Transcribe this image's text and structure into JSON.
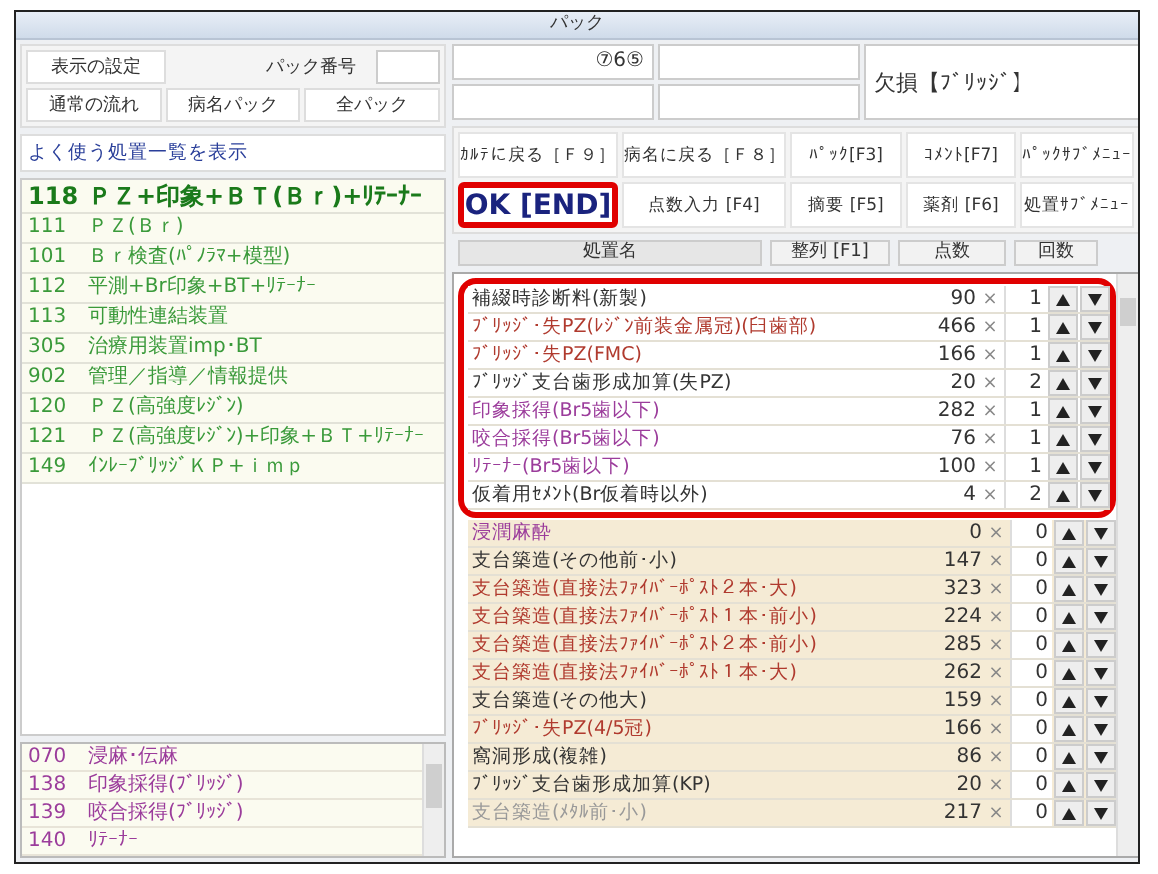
{
  "window": {
    "title": "パック"
  },
  "settings": {
    "display_button": "表示の設定",
    "pack_number_label": "パック番号",
    "buttons": [
      "通常の流れ",
      "病名パック",
      "全パック"
    ]
  },
  "frequent": {
    "header": "よく使う処置一覧を表示",
    "items": [
      {
        "code": "118",
        "name": "ＰＺ+印象+ＢＴ(Ｂｒ)+ﾘﾃｰﾅｰ",
        "selected": true
      },
      {
        "code": "111",
        "name": "ＰＺ(Ｂｒ)",
        "selected": false
      },
      {
        "code": "101",
        "name": "Ｂｒ検査(ﾊﾟﾉﾗﾏ+模型)",
        "selected": false
      },
      {
        "code": "112",
        "name": "平測+Br印象+BT+ﾘﾃｰﾅｰ",
        "selected": false
      },
      {
        "code": "113",
        "name": "可動性連結装置",
        "selected": false
      },
      {
        "code": "305",
        "name": "治療用装置imp･BT",
        "selected": false
      },
      {
        "code": "902",
        "name": "管理／指導／情報提供",
        "selected": false
      },
      {
        "code": "120",
        "name": "ＰＺ(高強度ﾚｼﾞﾝ)",
        "selected": false
      },
      {
        "code": "121",
        "name": "ＰＺ(高強度ﾚｼﾞﾝ)+印象+ＢＴ+ﾘﾃｰﾅｰ",
        "selected": false
      },
      {
        "code": "149",
        "name": "ｲﾝﾚｰﾌﾞﾘｯｼﾞＫＰ+ｉｍｐ",
        "selected": false
      }
    ]
  },
  "lower_list": [
    {
      "code": "070",
      "name": "浸麻･伝麻"
    },
    {
      "code": "138",
      "name": "印象採得(ﾌﾞﾘｯｼﾞ)"
    },
    {
      "code": "139",
      "name": "咬合採得(ﾌﾞﾘｯｼﾞ)"
    },
    {
      "code": "140",
      "name": "ﾘﾃｰﾅｰ"
    }
  ],
  "info": {
    "tooth_field": "⑦6⑤",
    "diagnosis": "欠損【ﾌﾞﾘｯｼﾞ】"
  },
  "buttons": [
    {
      "label": "ｶﾙﾃに戻る［Ｆ９］",
      "kind": "normal"
    },
    {
      "label": "病名に戻る［Ｆ８］",
      "kind": "normal"
    },
    {
      "label": "ﾊﾟｯｸ[F3]",
      "kind": "normal"
    },
    {
      "label": "ｺﾒﾝﾄ[F7]",
      "kind": "normal"
    },
    {
      "label": "ﾊﾟｯｸｻﾌﾞﾒﾆｭｰ",
      "kind": "normal"
    },
    {
      "label": "OK [END]",
      "kind": "primary"
    },
    {
      "label": "点数入力 [F4]",
      "kind": "normal"
    },
    {
      "label": "摘要 [F5]",
      "kind": "normal"
    },
    {
      "label": "薬剤 [F6]",
      "kind": "normal"
    },
    {
      "label": "処置ｻﾌﾞﾒﾆｭｰ",
      "kind": "normal"
    }
  ],
  "table": {
    "columns": [
      "処置名",
      "整列 [F1]",
      "点数",
      "回数"
    ],
    "highlighted_rows": [
      {
        "name": "補綴時診断料(新製)",
        "points": "90",
        "times": "×",
        "count": "1",
        "color": "#333333",
        "selected": true
      },
      {
        "name": "ﾌﾞﾘｯｼﾞ･失PZ(ﾚｼﾞﾝ前装金属冠)(臼歯部)",
        "points": "466",
        "times": "×",
        "count": "1",
        "color": "#b03a2e",
        "selected": true
      },
      {
        "name": "ﾌﾞﾘｯｼﾞ･失PZ(FMC)",
        "points": "166",
        "times": "×",
        "count": "1",
        "color": "#b03a2e",
        "selected": true
      },
      {
        "name": "ﾌﾞﾘｯｼﾞ支台歯形成加算(失PZ)",
        "points": "20",
        "times": "×",
        "count": "2",
        "color": "#333333",
        "selected": true
      },
      {
        "name": "印象採得(Br5歯以下)",
        "points": "282",
        "times": "×",
        "count": "1",
        "color": "#9b3c9b",
        "selected": true
      },
      {
        "name": "咬合採得(Br5歯以下)",
        "points": "76",
        "times": "×",
        "count": "1",
        "color": "#9b3c9b",
        "selected": true
      },
      {
        "name": "ﾘﾃｰﾅｰ(Br5歯以下)",
        "points": "100",
        "times": "×",
        "count": "1",
        "color": "#9b3c9b",
        "selected": true
      },
      {
        "name": "仮着用ｾﾒﾝﾄ(Br仮着時以外)",
        "points": "4",
        "times": "×",
        "count": "2",
        "color": "#333333",
        "selected": true
      }
    ],
    "rows": [
      {
        "name": "浸潤麻酔",
        "points": "0",
        "times": "×",
        "count": "0",
        "color": "#9b3c9b",
        "selected": false
      },
      {
        "name": "支台築造(その他前･小)",
        "points": "147",
        "times": "×",
        "count": "0",
        "color": "#333333",
        "selected": false
      },
      {
        "name": "支台築造(直接法ﾌｧｲﾊﾞｰﾎﾟｽﾄ２本･大)",
        "points": "323",
        "times": "×",
        "count": "0",
        "color": "#b03a2e",
        "selected": false
      },
      {
        "name": "支台築造(直接法ﾌｧｲﾊﾞｰﾎﾟｽﾄ１本･前小)",
        "points": "224",
        "times": "×",
        "count": "0",
        "color": "#b03a2e",
        "selected": false
      },
      {
        "name": "支台築造(直接法ﾌｧｲﾊﾞｰﾎﾟｽﾄ２本･前小)",
        "points": "285",
        "times": "×",
        "count": "0",
        "color": "#b03a2e",
        "selected": false
      },
      {
        "name": "支台築造(直接法ﾌｧｲﾊﾞｰﾎﾟｽﾄ１本･大)",
        "points": "262",
        "times": "×",
        "count": "0",
        "color": "#b03a2e",
        "selected": false
      },
      {
        "name": "支台築造(その他大)",
        "points": "159",
        "times": "×",
        "count": "0",
        "color": "#333333",
        "selected": false
      },
      {
        "name": "ﾌﾞﾘｯｼﾞ･失PZ(4/5冠)",
        "points": "166",
        "times": "×",
        "count": "0",
        "color": "#b03a2e",
        "selected": false
      },
      {
        "name": "窩洞形成(複雑)",
        "points": "86",
        "times": "×",
        "count": "0",
        "color": "#333333",
        "selected": false
      },
      {
        "name": "ﾌﾞﾘｯｼﾞ支台歯形成加算(KP)",
        "points": "20",
        "times": "×",
        "count": "0",
        "color": "#333333",
        "selected": false
      },
      {
        "name": "支台築造(ﾒﾀﾙ前･小)",
        "points": "217",
        "times": "×",
        "count": "0",
        "color": "#999999",
        "selected": false
      }
    ]
  }
}
